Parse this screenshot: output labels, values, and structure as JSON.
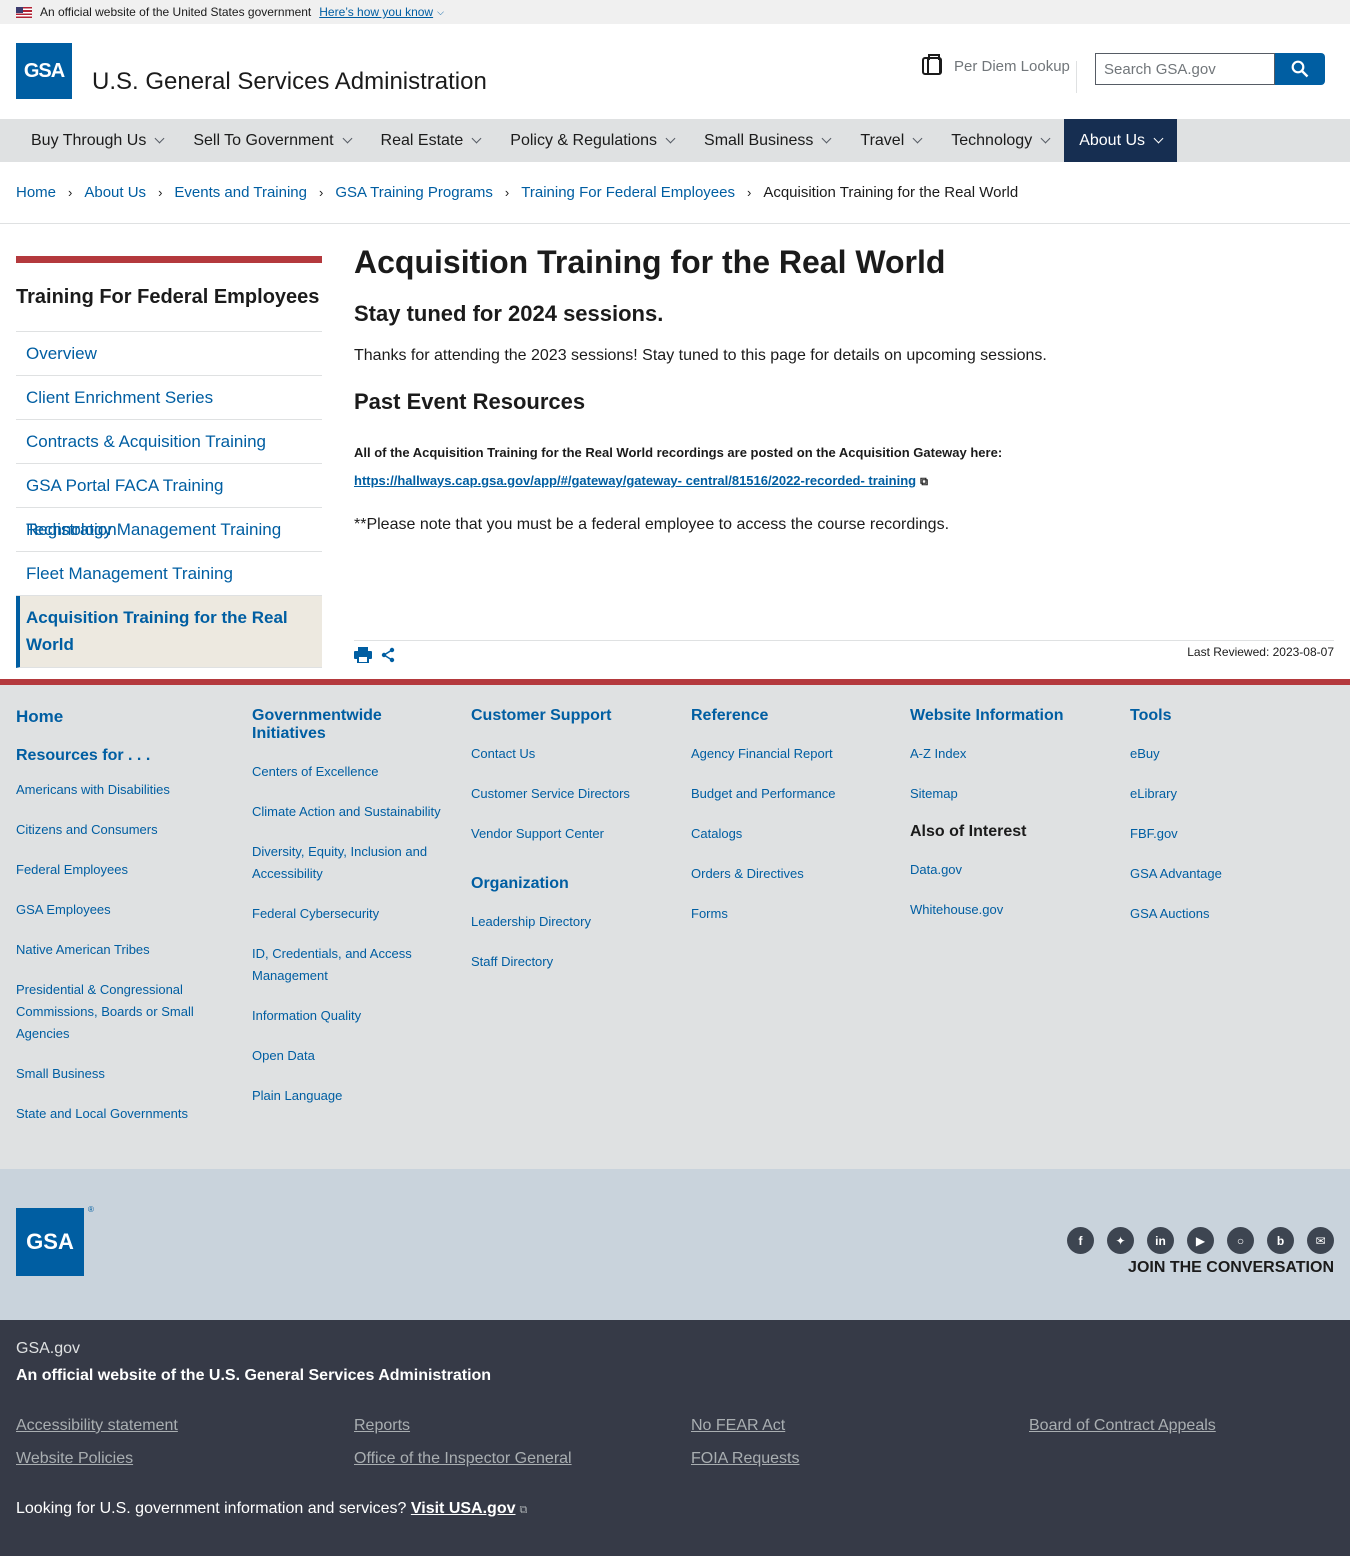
{
  "gov_banner": {
    "official": "An official website of the United States government",
    "how": "Here’s how you know"
  },
  "header": {
    "logo": "GSA",
    "title": "U.S. General Services Administration",
    "per_diem": "Per Diem Lookup",
    "search_placeholder": "Search GSA.gov"
  },
  "nav": {
    "items": [
      "Buy Through Us",
      "Sell To Government",
      "Real Estate",
      "Policy & Regulations",
      "Small Business",
      "Travel",
      "Technology",
      "About Us"
    ]
  },
  "breadcrumb": {
    "items": [
      "Home",
      "About Us",
      "Events and Training",
      "GSA Training Programs",
      "Training For Federal Employees"
    ],
    "current": "Acquisition Training for the Real World"
  },
  "sidenav": {
    "heading": "Training For Federal Employees",
    "items": [
      "Overview",
      "Client Enrichment Series",
      "Contracts & Acquisition Training",
      "GSA Portal FACA Training Registration",
      "Technology Management Training",
      "Fleet Management Training"
    ],
    "current": "Acquisition Training for the Real World"
  },
  "content": {
    "title": "Acquisition Training for the Real World",
    "subtitle": "Stay tuned for 2024 sessions.",
    "lead": "Thanks for attending the 2023 sessions! Stay tuned to this page for details on upcoming sessions.",
    "past_heading": "Past Event Resources",
    "recordings_text": "All of the Acquisition Training for the Real World recordings are posted on the Acquisition Gateway here: ",
    "recordings_link": "https://hallways.cap.gsa.gov/app/#/gateway/gateway- central/81516/2022-recorded- training",
    "note": "**Please note that you must be a federal employee to access the course recordings.",
    "last_reviewed": "Last Reviewed: 2023-08-07"
  },
  "footer": {
    "home": "Home",
    "resources_for": "Resources for . . .",
    "resources": [
      "Americans with Disabilities",
      "Citizens and Consumers",
      "Federal Employees",
      "GSA Employees",
      "Native American Tribes",
      "Presidential & Congressional Commissions, Boards or Small Agencies",
      "Small Business",
      "State and Local Governments"
    ],
    "governmentwide_title": "Governmentwide Initiatives",
    "governmentwide": [
      "Centers of Excellence",
      "Climate Action and Sustainability",
      "Diversity, Equity, Inclusion and Accessibility",
      "Federal Cybersecurity",
      "ID, Credentials, and Access Management",
      "Information Quality",
      "Open Data",
      "Plain Language"
    ],
    "support_title": "Customer Support",
    "support": [
      "Contact Us",
      "Customer Service Directors",
      "Vendor Support Center"
    ],
    "organization_title": "Organization",
    "organization": [
      "Leadership Directory",
      "Staff Directory"
    ],
    "reference_title": "Reference",
    "reference": [
      "Agency Financial Report",
      "Budget and Performance",
      "Catalogs",
      "Orders & Directives",
      "Forms"
    ],
    "website_title": "Website Information",
    "website": [
      "A-Z Index",
      "Sitemap"
    ],
    "interest_title": "Also of Interest",
    "interest": [
      "Data.gov",
      "Whitehouse.gov"
    ],
    "tools_title": "Tools",
    "tools": [
      "eBuy",
      "eLibrary",
      "FBF.gov",
      "GSA Advantage",
      "GSA Auctions"
    ],
    "logo": "GSA",
    "join": "JOIN THE CONVERSATION",
    "site": "GSA.gov",
    "official": "An official website of the U.S. General Services Administration",
    "bottom_links": [
      "Accessibility statement",
      "Reports",
      "No FEAR Act",
      "Board of Contract Appeals",
      "Website Policies",
      "Office of the Inspector General",
      "FOIA Requests"
    ],
    "usa_text": "Looking for U.S. government information and services? ",
    "usa_link": "Visit USA.gov"
  }
}
